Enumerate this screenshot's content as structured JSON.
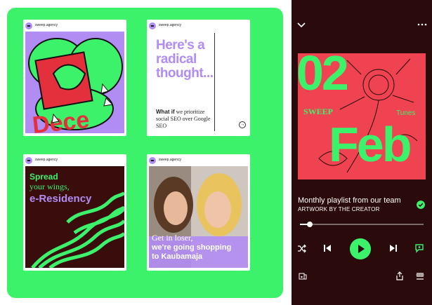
{
  "feed": {
    "cards": [
      {
        "account": "sweep.agency"
      },
      {
        "account": "sweep.agency",
        "headline": "Here's a radical thought...",
        "body_bold": "What if",
        "body": " we prioritize social SEO over Google SEO"
      },
      {
        "account": "sweep.agency",
        "line1": "Spread",
        "line2": "your wings,",
        "line3": "e-Residency"
      },
      {
        "account": "sweep.agency",
        "line1": "Get in loser,",
        "line2": "we're going shopping",
        "line3": "to Kaubamaja"
      }
    ]
  },
  "player": {
    "artwork": {
      "day": "02",
      "month": "Feb",
      "brand": "SWEEP",
      "tag": "Tunes"
    },
    "title": "Monthly playlist from our team",
    "subtitle": "ARTWORK BY THE CREATOR",
    "progress": 0.08,
    "accent": "#3df26b",
    "background": "#2a0a0a"
  }
}
